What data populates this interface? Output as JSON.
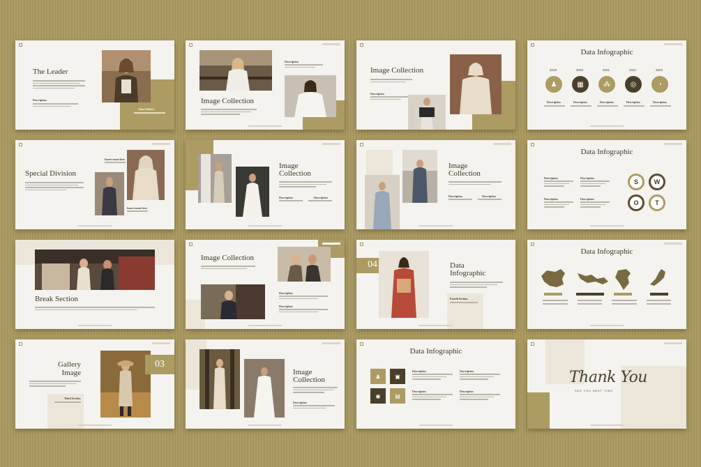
{
  "slides": {
    "s1": {
      "title": "The Leader",
      "desc_label": "Description",
      "caption": "Anna Andrea"
    },
    "s2": {
      "title": "Image Collection",
      "desc_label": "Description"
    },
    "s3": {
      "title": "Image Collection",
      "desc_label": "Description"
    },
    "s4": {
      "title": "Data Infographic",
      "years": [
        "2019",
        "2020",
        "2021",
        "2022",
        "2023"
      ],
      "desc_label": "Description"
    },
    "s5": {
      "title": "Special Division",
      "name_label_1": "Insert name here",
      "name_label_2": "Insert name here"
    },
    "s6": {
      "title_line1": "Image",
      "title_line2": "Collection",
      "desc_label_1": "Description",
      "desc_label_2": "Description"
    },
    "s7": {
      "title_line1": "Image",
      "title_line2": "Collection",
      "desc_label_1": "Description",
      "desc_label_2": "Description"
    },
    "s8": {
      "title": "Data Infographic",
      "swot": [
        "S",
        "W",
        "O",
        "T"
      ],
      "desc_label": "Description"
    },
    "s9": {
      "title": "Break Section"
    },
    "s10": {
      "title": "Image Collection",
      "desc_label_1": "Description",
      "desc_label_2": "Description"
    },
    "s11": {
      "number": "04",
      "title_line1": "Data",
      "title_line2": "Infographic",
      "section_label": "Fourth Section"
    },
    "s12": {
      "title": "Data Infographic"
    },
    "s13": {
      "title_line1": "Gallery",
      "title_line2": "Image",
      "number": "03",
      "section_label": "Third Section"
    },
    "s14": {
      "title_line1": "Image",
      "title_line2": "Collection",
      "desc_label": "Description"
    },
    "s15": {
      "title": "Data Infographic",
      "desc_label": "Description"
    },
    "s16": {
      "title": "Thank You",
      "subtitle": "SEE YOU NEXT TIME"
    }
  },
  "colors": {
    "accent": "#ac9b62",
    "dark": "#4a3f2a",
    "background": "#a8975f",
    "slide": "#f5f3f0"
  },
  "icons": [
    "people-icon",
    "calendar-icon",
    "network-icon",
    "target-icon",
    "chart-icon",
    "shopping-icon",
    "money-icon"
  ]
}
